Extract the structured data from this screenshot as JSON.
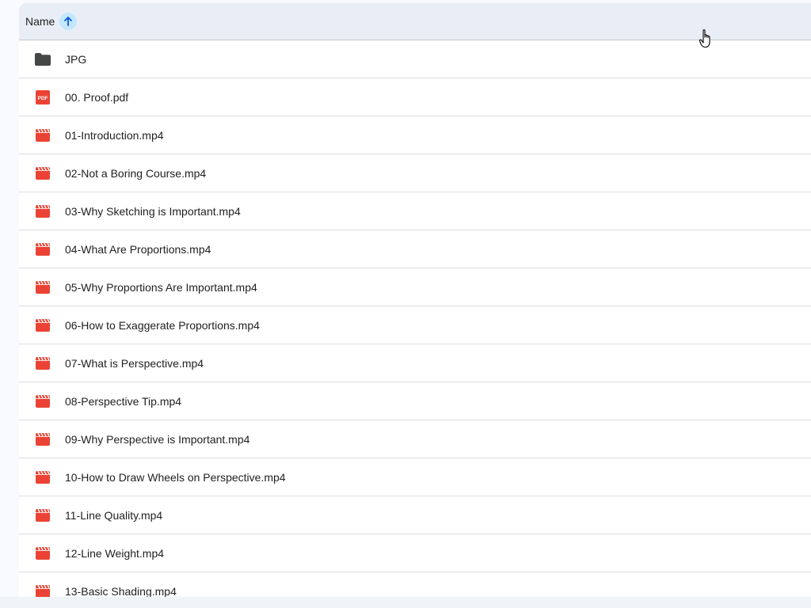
{
  "header": {
    "name_label": "Name",
    "sort_direction": "ascending"
  },
  "files": [
    {
      "name": "JPG",
      "icon": "folder-icon"
    },
    {
      "name": "00. Proof.pdf",
      "icon": "pdf-icon",
      "icon_text": "PDF"
    },
    {
      "name": "01-Introduction.mp4",
      "icon": "video-icon"
    },
    {
      "name": "02-Not a Boring Course.mp4",
      "icon": "video-icon"
    },
    {
      "name": "03-Why Sketching is Important.mp4",
      "icon": "video-icon"
    },
    {
      "name": "04-What Are Proportions.mp4",
      "icon": "video-icon"
    },
    {
      "name": "05-Why Proportions Are Important.mp4",
      "icon": "video-icon"
    },
    {
      "name": "06-How to Exaggerate Proportions.mp4",
      "icon": "video-icon"
    },
    {
      "name": "07-What is Perspective.mp4",
      "icon": "video-icon"
    },
    {
      "name": "08-Perspective Tip.mp4",
      "icon": "video-icon"
    },
    {
      "name": "09-Why Perspective is Important.mp4",
      "icon": "video-icon"
    },
    {
      "name": "10-How to Draw Wheels on Perspective.mp4",
      "icon": "video-icon"
    },
    {
      "name": "11-Line Quality.mp4",
      "icon": "video-icon"
    },
    {
      "name": "12-Line Weight.mp4",
      "icon": "video-icon"
    },
    {
      "name": "13-Basic Shading.mp4",
      "icon": "video-icon"
    }
  ],
  "colors": {
    "folder": "#444746",
    "video": "#ea4335",
    "pdf": "#ea4335",
    "header_bg": "#e9eef6",
    "sort_accent": "#c2e7ff",
    "sort_arrow": "#0b57d0"
  }
}
